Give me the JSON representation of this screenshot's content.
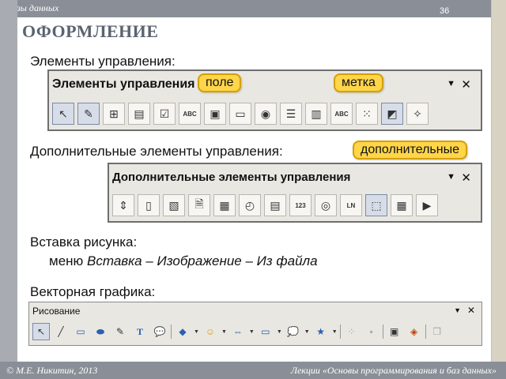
{
  "header": {
    "section": "Базы данных",
    "page_number": "36",
    "title": "ОФОРМЛЕНИЕ"
  },
  "footer": {
    "author": "© М.Е. Никитин, 2013",
    "course": "Лекции «Основы программирования и баз данных»"
  },
  "labels": {
    "controls": "Элементы управления:",
    "extra_controls": "Дополнительные элементы управления:",
    "insert_picture": "Вставка рисунка:",
    "menu_prefix": "меню ",
    "menu_path": "Вставка – Изображение – Из файла",
    "vector": "Векторная графика:"
  },
  "callouts": {
    "field": "поле",
    "label": "метка",
    "extra": "дополнительные"
  },
  "toolbar1": {
    "title": "Элементы управления",
    "menu_glyph": "▼",
    "close_glyph": "✕",
    "buttons": [
      "pointer-icon",
      "design-mode-icon",
      "form-icon",
      "properties-icon",
      "checkbox-icon",
      "textbox-icon",
      "image-button-icon",
      "push-button-icon",
      "option-button-icon",
      "listbox-icon",
      "combobox-icon",
      "label-icon",
      "more-controls-icon",
      "form-design-icon",
      "wizards-icon"
    ],
    "text_glyphs": {
      "textbox": "ABC",
      "label": "ABC"
    }
  },
  "toolbar2": {
    "title": "Дополнительные элементы управления",
    "menu_glyph": "▼",
    "close_glyph": "✕",
    "buttons": [
      "spin-button-icon",
      "scrollbar-icon",
      "image-control-icon",
      "file-selection-icon",
      "date-field-icon",
      "time-field-icon",
      "numeric-field-icon",
      "formatted-field-icon",
      "currency-field-icon",
      "pattern-field-icon",
      "group-box-icon",
      "table-control-icon",
      "navigation-bar-icon"
    ],
    "text_glyphs": {
      "formatted": "123",
      "pattern": "LN"
    }
  },
  "toolbar3": {
    "title": "Рисование",
    "menu_glyph": "▼",
    "close_glyph": "✕",
    "text_glyph": "T"
  }
}
